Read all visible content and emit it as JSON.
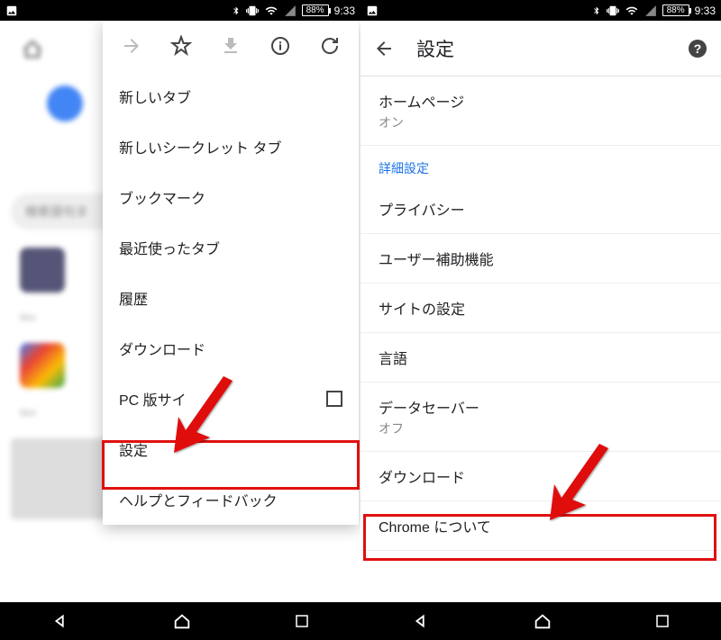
{
  "status": {
    "time": "9:33",
    "battery": "88%"
  },
  "left": {
    "search_placeholder": "検索語句ま",
    "menu": {
      "items": [
        "新しいタブ",
        "新しいシークレット タブ",
        "ブックマーク",
        "最近使ったタブ",
        "履歴",
        "ダウンロード",
        "PC 版サイ",
        "設定",
        "ヘルプとフィードバック"
      ]
    }
  },
  "right": {
    "title": "設定",
    "homepage": {
      "label": "ホームページ",
      "status": "オン"
    },
    "section": "詳細設定",
    "rows": [
      "プライバシー",
      "ユーザー補助機能",
      "サイトの設定",
      "言語"
    ],
    "datasaver": {
      "label": "データセーバー",
      "status": "オフ"
    },
    "download": "ダウンロード",
    "about": "Chrome について"
  }
}
